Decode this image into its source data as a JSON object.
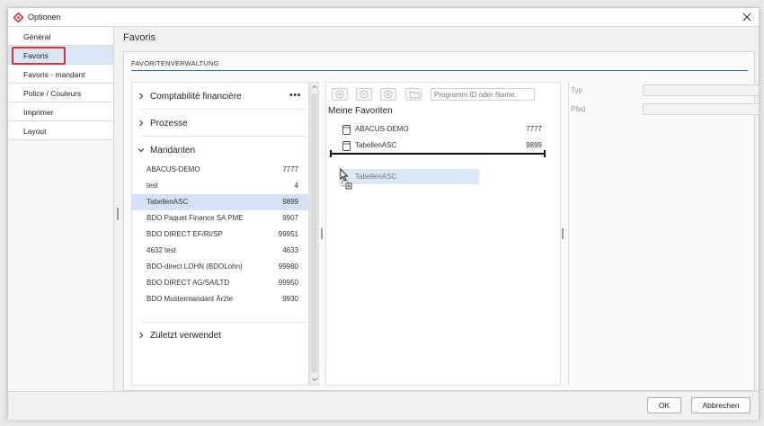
{
  "window": {
    "title": "Optionen"
  },
  "sidebar": {
    "items": [
      {
        "label": "Général"
      },
      {
        "label": "Favoris"
      },
      {
        "label": "Favoris - mandant"
      },
      {
        "label": "Police / Couleurs"
      },
      {
        "label": "Imprimer"
      },
      {
        "label": "Layout"
      }
    ],
    "selected": "Favoris"
  },
  "main": {
    "heading": "Favoris",
    "section_title": "FAVORITENVERWALTUNG",
    "groups": [
      {
        "label": "Comptabilité financière",
        "expanded": false
      },
      {
        "label": "Prozesse",
        "expanded": false
      },
      {
        "label": "Mandanten",
        "expanded": true
      },
      {
        "label": "Zuletzt verwendet",
        "expanded": false
      }
    ],
    "more_menu": "•••",
    "mandanten": [
      {
        "name": "ABACUS-DEMO",
        "number": "7777"
      },
      {
        "name": "test",
        "number": "4"
      },
      {
        "name": "TabellenASC",
        "number": "9899",
        "selected": true
      },
      {
        "name": "BDO Paquet Finance SA PME",
        "number": "9907"
      },
      {
        "name": "BDO DIRECT EF/RI/SP",
        "number": "99951"
      },
      {
        "name": "4632 test",
        "number": "4633"
      },
      {
        "name": "BDO-direct LOHN (BDOLohn)",
        "number": "99980"
      },
      {
        "name": "BDO DIRECT AG/SA/LTD",
        "number": "99950"
      },
      {
        "name": "BDO Mustermandant Ärzte",
        "number": "9930"
      }
    ],
    "favorites_toolbar": {
      "search_placeholder": "Programm ID oder Name"
    },
    "favorites_title": "Meine Favoriten",
    "favorites": [
      {
        "name": "ABACUS-DEMO",
        "number": "7777"
      },
      {
        "name": "TabellenASC",
        "number": "9899"
      }
    ],
    "drag_item": "TabellenASC",
    "properties": {
      "type_label": "Typ",
      "path_label": "Pfad",
      "type_value": "",
      "path_value": ""
    }
  },
  "footer": {
    "ok_label": "OK",
    "cancel_label": "Abbrechen"
  },
  "colors": {
    "accent": "#2a6db5",
    "selection": "#d3e3f5",
    "highlight_border": "#d6333c"
  }
}
